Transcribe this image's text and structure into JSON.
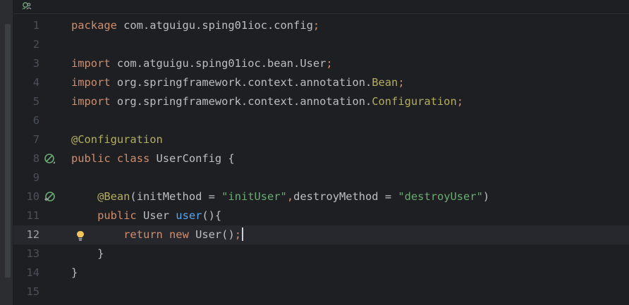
{
  "editor": {
    "current_line": "12",
    "lines": [
      {
        "num": "1",
        "tokens": [
          {
            "t": "package",
            "c": "kw"
          },
          {
            "t": " com.atguigu.sping01ioc.config",
            "c": ""
          },
          {
            "t": ";",
            "c": "kw"
          }
        ]
      },
      {
        "num": "2",
        "tokens": []
      },
      {
        "num": "3",
        "tokens": [
          {
            "t": "import",
            "c": "kw"
          },
          {
            "t": " com.atguigu.sping01ioc.bean.User",
            "c": ""
          },
          {
            "t": ";",
            "c": "kw"
          }
        ]
      },
      {
        "num": "4",
        "tokens": [
          {
            "t": "import",
            "c": "kw"
          },
          {
            "t": " org.springframework.context.annotation.",
            "c": ""
          },
          {
            "t": "Bean",
            "c": "ann"
          },
          {
            "t": ";",
            "c": "kw"
          }
        ]
      },
      {
        "num": "5",
        "tokens": [
          {
            "t": "import",
            "c": "kw"
          },
          {
            "t": " org.springframework.context.annotation.",
            "c": ""
          },
          {
            "t": "Configuration",
            "c": "ann"
          },
          {
            "t": ";",
            "c": "kw"
          }
        ]
      },
      {
        "num": "6",
        "tokens": []
      },
      {
        "num": "7",
        "tokens": [
          {
            "t": "@Configuration",
            "c": "ann"
          }
        ]
      },
      {
        "num": "8",
        "tokens": [
          {
            "t": "public",
            "c": "kw"
          },
          {
            "t": " ",
            "c": ""
          },
          {
            "t": "class",
            "c": "kw"
          },
          {
            "t": " UserConfig {",
            "c": ""
          }
        ]
      },
      {
        "num": "9",
        "tokens": []
      },
      {
        "num": "10",
        "tokens": [
          {
            "t": "    ",
            "c": ""
          },
          {
            "t": "@Bean",
            "c": "ann"
          },
          {
            "t": "(initMethod = ",
            "c": ""
          },
          {
            "t": "\"initUser\"",
            "c": "str"
          },
          {
            "t": ",",
            "c": "kw"
          },
          {
            "t": "destroyMethod = ",
            "c": ""
          },
          {
            "t": "\"destroyUser\"",
            "c": "str"
          },
          {
            "t": ")",
            "c": ""
          }
        ]
      },
      {
        "num": "11",
        "tokens": [
          {
            "t": "    ",
            "c": ""
          },
          {
            "t": "public",
            "c": "kw"
          },
          {
            "t": " User ",
            "c": ""
          },
          {
            "t": "user",
            "c": "fn"
          },
          {
            "t": "(){",
            "c": ""
          }
        ]
      },
      {
        "num": "12",
        "tokens": [
          {
            "t": "        ",
            "c": ""
          },
          {
            "t": "return",
            "c": "kw"
          },
          {
            "t": " ",
            "c": ""
          },
          {
            "t": "new",
            "c": "kw"
          },
          {
            "t": " User()",
            "c": ""
          },
          {
            "t": ";",
            "c": "kw"
          }
        ]
      },
      {
        "num": "13",
        "tokens": [
          {
            "t": "    }",
            "c": ""
          }
        ]
      },
      {
        "num": "14",
        "tokens": [
          {
            "t": "}",
            "c": ""
          }
        ]
      },
      {
        "num": "15",
        "tokens": []
      }
    ],
    "gutter_icons": [
      {
        "line": "8",
        "icon": "bean-config-icon"
      },
      {
        "line": "10",
        "icon": "bean-method-icon"
      }
    ],
    "intention_bulb_line": "12"
  },
  "colors": {
    "background": "#1e1f22",
    "keyword": "#cf8e6d",
    "annotation": "#b3ae60",
    "string": "#6aab73",
    "function": "#56a8f5",
    "text": "#bcbec4",
    "line_number": "#4b5059"
  }
}
